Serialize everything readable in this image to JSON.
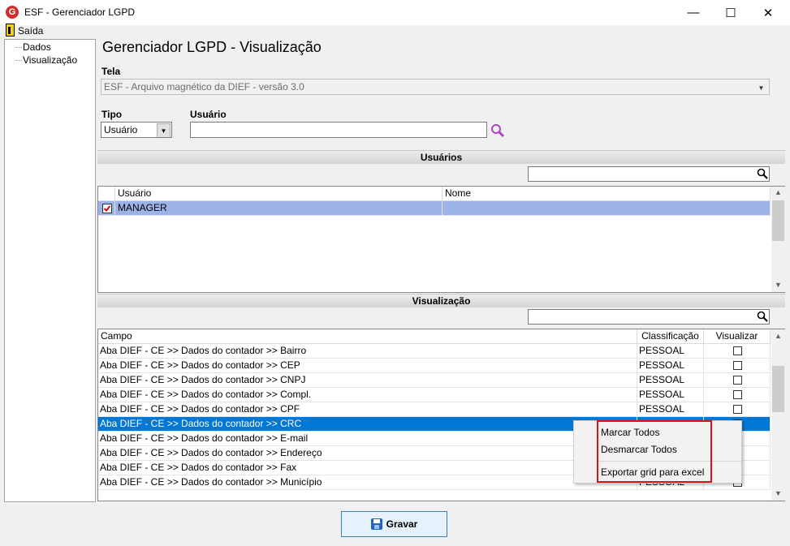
{
  "window": {
    "title": "ESF - Gerenciador LGPD",
    "app_icon": "G",
    "minimize": "—",
    "maximize": "☐",
    "close": "✕"
  },
  "menu": {
    "exit_label": "Saída"
  },
  "tree": {
    "items": [
      "Dados",
      "Visualização"
    ]
  },
  "page": {
    "title": "Gerenciador LGPD - Visualização"
  },
  "tela": {
    "label": "Tela",
    "value": "ESF - Arquivo magnético da DIEF - versão 3.0"
  },
  "tipo": {
    "label": "Tipo",
    "value": "Usuário"
  },
  "usuario": {
    "label": "Usuário",
    "value": ""
  },
  "users_section": {
    "title": "Usuários",
    "search_value": "",
    "columns": [
      "Usuário",
      "Nome"
    ],
    "rows": [
      {
        "checked": true,
        "usuario": "MANAGER",
        "nome": ""
      }
    ]
  },
  "visual_section": {
    "title": "Visualização",
    "search_value": "",
    "columns": [
      "Campo",
      "Classificação",
      "Visualizar"
    ],
    "rows": [
      {
        "campo": "Aba DIEF - CE >> Dados do contador >> Bairro",
        "classificacao": "PESSOAL",
        "visualizar": false
      },
      {
        "campo": "Aba DIEF - CE >> Dados do contador >> CEP",
        "classificacao": "PESSOAL",
        "visualizar": false
      },
      {
        "campo": "Aba DIEF - CE >> Dados do contador >> CNPJ",
        "classificacao": "PESSOAL",
        "visualizar": false
      },
      {
        "campo": "Aba DIEF - CE >> Dados do contador >> Compl.",
        "classificacao": "PESSOAL",
        "visualizar": false
      },
      {
        "campo": "Aba DIEF - CE >> Dados do contador >> CPF",
        "classificacao": "PESSOAL",
        "visualizar": false
      },
      {
        "campo": "Aba DIEF - CE >> Dados do contador >> CRC",
        "classificacao": "",
        "visualizar": false,
        "selected": true
      },
      {
        "campo": "Aba DIEF - CE >> Dados do contador >> E-mail",
        "classificacao": "",
        "visualizar": false
      },
      {
        "campo": "Aba DIEF - CE >> Dados do contador >> Endereço",
        "classificacao": "",
        "visualizar": false
      },
      {
        "campo": "Aba DIEF - CE >> Dados do contador >> Fax",
        "classificacao": "",
        "visualizar": false
      },
      {
        "campo": "Aba DIEF - CE >> Dados do contador >> Município",
        "classificacao": "PESSOAL",
        "visualizar": false
      }
    ]
  },
  "context_menu": {
    "items": [
      "Marcar Todos",
      "Desmarcar Todos",
      "Exportar grid para excel"
    ]
  },
  "save_button": {
    "label": "Gravar"
  },
  "colors": {
    "selection": "#0078d7",
    "row_highlight": "#9bb3e6",
    "annotation": "#e0101a",
    "search_icon": "#b044c8"
  }
}
